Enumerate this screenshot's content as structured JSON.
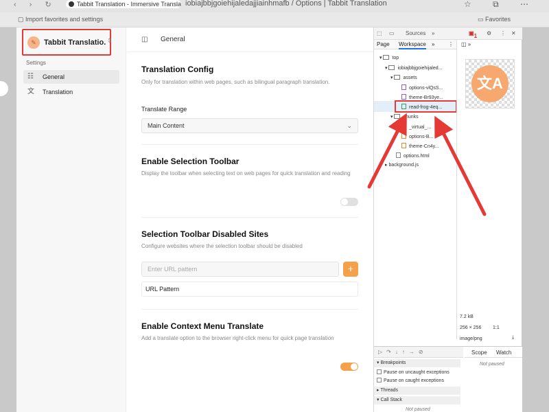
{
  "browser": {
    "tab_title": "Tabbit Translation - Immersive Translate",
    "url": "iobiajbbjgoiehijaledajjiainhmafb / Options | Tabbit Translation",
    "bookmark_import": "Import favorites and settings",
    "bookmark_favorites": "Favorites"
  },
  "sidebar": {
    "brand": "Tabbit Translatio...",
    "section_label": "Settings",
    "items": [
      {
        "label": "General",
        "icon": "sliders-icon"
      },
      {
        "label": "Translation",
        "icon": "translate-icon"
      }
    ]
  },
  "main": {
    "header_title": "General",
    "translation_config": {
      "title": "Translation Config",
      "desc": "Only for translation within web pages, such as bilingual paragraph translation.",
      "range_label": "Translate Range",
      "range_value": "Main Content"
    },
    "selection_toolbar": {
      "title": "Enable Selection Toolbar",
      "desc": "Display the toolbar when selecting text on web pages for quick translation and reading",
      "enabled": false
    },
    "disabled_sites": {
      "title": "Selection Toolbar Disabled Sites",
      "desc": "Configure websites where the selection toolbar should be disabled",
      "placeholder": "Enter URL pattern",
      "add_label": "+",
      "table_header": "URL Pattern"
    },
    "context_menu": {
      "title": "Enable Context Menu Translate",
      "desc": "Add a translate option to the browser right-click menu for quick page translation",
      "enabled": true
    }
  },
  "devtools": {
    "panel": "Sources",
    "more": "»",
    "error_count": "1",
    "subtabs": [
      "Page",
      "Workspace"
    ],
    "tree": {
      "top": "top",
      "origin": "iobiajbbjgoiehijaled...",
      "assets": "assets",
      "files_assets": [
        "options-vlQsS...",
        "theme-Br93ye...",
        "read-frog-4eq..."
      ],
      "chunks": "chunks",
      "files_chunks": [
        "_virtual_...",
        "options-B...",
        "theme-Cn4y..."
      ],
      "options_html": "options.html",
      "background": "background.js"
    },
    "preview": {
      "glyph": "文A",
      "size": "7.2 kB",
      "dimensions": "256 × 256",
      "ratio": "1:1",
      "mime": "image/png"
    },
    "debugger": {
      "breakpoints": "Breakpoints",
      "pause_uncaught": "Pause on uncaught exceptions",
      "pause_caught": "Pause on caught exceptions",
      "threads": "Threads",
      "call_stack": "Call Stack",
      "not_paused": "Not paused",
      "scope": "Scope",
      "watch": "Watch"
    }
  },
  "colors": {
    "accent": "#f5a04a",
    "annotation": "#e53935"
  }
}
